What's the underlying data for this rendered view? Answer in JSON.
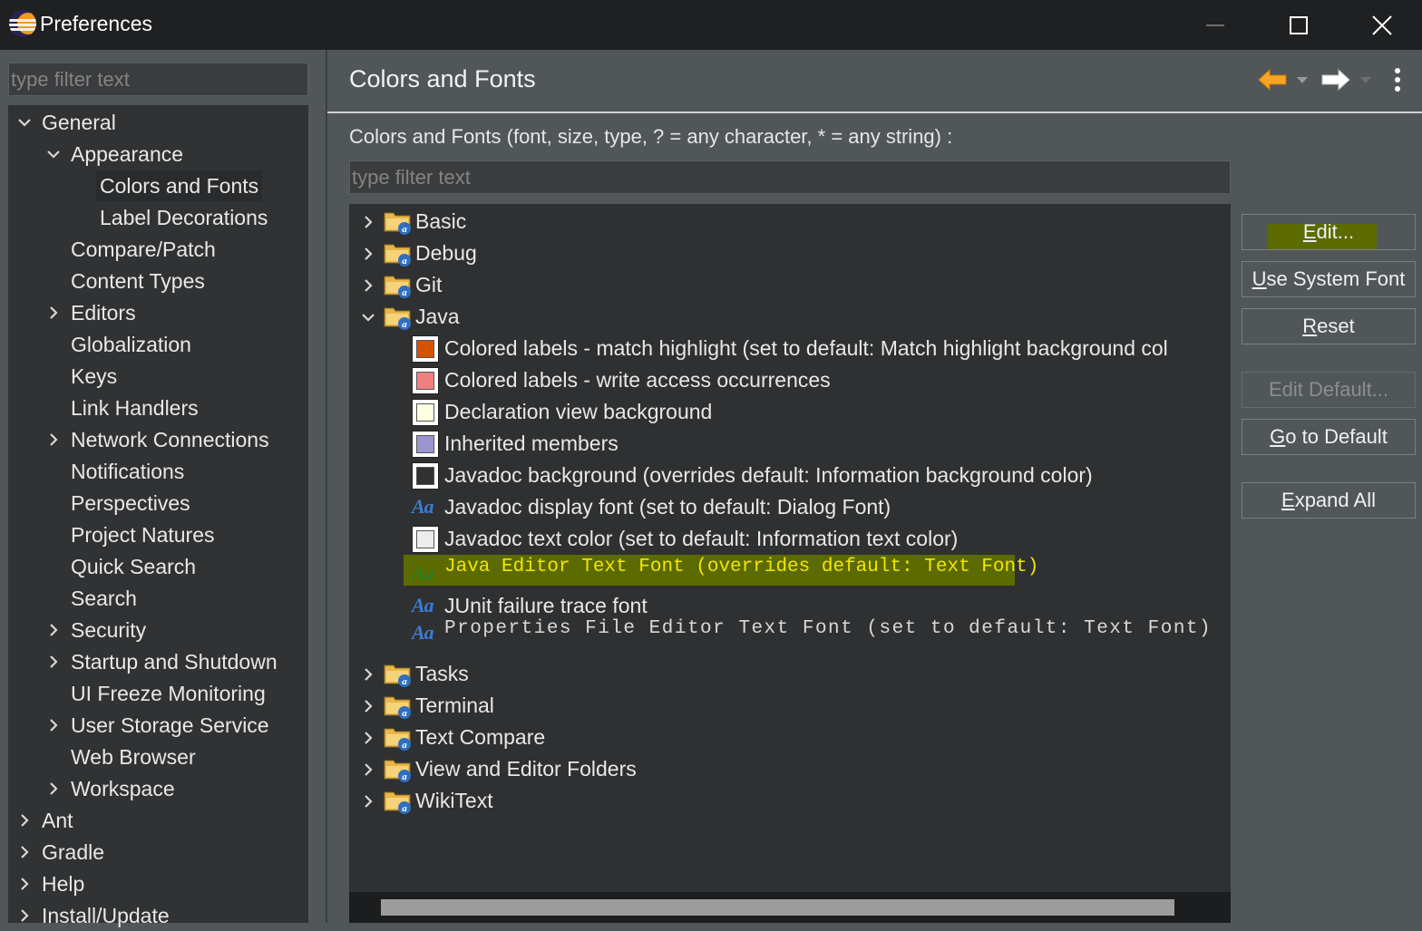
{
  "window": {
    "title": "Preferences",
    "controls": {
      "minimize": "minimize-icon",
      "maximize": "maximize-icon",
      "close": "close-icon"
    }
  },
  "sidebar": {
    "filter_placeholder": "type filter text",
    "items": [
      {
        "label": "General",
        "expanded": true
      },
      {
        "label": "Appearance",
        "expanded": true
      },
      {
        "label": "Colors and Fonts",
        "selected": true
      },
      {
        "label": "Label Decorations"
      },
      {
        "label": "Compare/Patch"
      },
      {
        "label": "Content Types"
      },
      {
        "label": "Editors",
        "expandable": true
      },
      {
        "label": "Globalization"
      },
      {
        "label": "Keys"
      },
      {
        "label": "Link Handlers"
      },
      {
        "label": "Network Connections",
        "expandable": true
      },
      {
        "label": "Notifications"
      },
      {
        "label": "Perspectives"
      },
      {
        "label": "Project Natures"
      },
      {
        "label": "Quick Search"
      },
      {
        "label": "Search"
      },
      {
        "label": "Security",
        "expandable": true
      },
      {
        "label": "Startup and Shutdown",
        "expandable": true
      },
      {
        "label": "UI Freeze Monitoring"
      },
      {
        "label": "User Storage Service",
        "expandable": true
      },
      {
        "label": "Web Browser"
      },
      {
        "label": "Workspace",
        "expandable": true
      },
      {
        "label": "Ant",
        "expandable": true
      },
      {
        "label": "Gradle",
        "expandable": true
      },
      {
        "label": "Help",
        "expandable": true
      },
      {
        "label": "Install/Update",
        "expandable": true
      }
    ]
  },
  "main": {
    "title": "Colors and Fonts",
    "filter_description": "Colors and Fonts (font, size, type, ? = any character, * = any string) :",
    "filter_placeholder": "type filter text",
    "tree": {
      "categories_before": [
        "Basic",
        "Debug",
        "Git"
      ],
      "java": {
        "label": "Java",
        "children": [
          {
            "label": "Colored labels - match highlight (set to default: Match highlight background col",
            "kind": "color",
            "color": "#d35400"
          },
          {
            "label": "Colored labels - write access occurrences",
            "kind": "color",
            "color": "#f08080"
          },
          {
            "label": "Declaration view background",
            "kind": "color",
            "color": "#fefee2"
          },
          {
            "label": "Inherited members",
            "kind": "color",
            "color": "#9b95cf"
          },
          {
            "label": "Javadoc background (overrides default: Information background color)",
            "kind": "color",
            "color": "#2f3133"
          },
          {
            "label": "Javadoc display font (set to default: Dialog Font)",
            "kind": "font"
          },
          {
            "label": "Javadoc text color (set to default: Information text color)",
            "kind": "color",
            "color": "#ececec"
          },
          {
            "label": "Java Editor Text Font (overrides default: Text Font)",
            "kind": "font",
            "selected": true
          },
          {
            "label": "JUnit failure trace font",
            "kind": "font"
          },
          {
            "label": "Properties File Editor Text Font (set to default: Text Font)",
            "kind": "font"
          }
        ]
      },
      "categories_after": [
        "Tasks",
        "Terminal",
        "Text Compare",
        "View and Editor Folders",
        "WikiText"
      ]
    },
    "font_icon_glyph": "Aa"
  },
  "buttons": {
    "edit": {
      "mnemonic": "E",
      "rest": "dit..."
    },
    "use_system_font": {
      "mnemonic": "U",
      "rest": "se System Font"
    },
    "reset": {
      "mnemonic": "R",
      "rest": "eset"
    },
    "edit_default": {
      "label": "Edit Default..."
    },
    "go_to_default": {
      "mnemonic": "G",
      "rest": "o to Default"
    },
    "expand_all": {
      "mnemonic": "E",
      "rest": "xpand All"
    }
  },
  "colors": {
    "highlight": "#5c6b00",
    "highlight_text": "#f2e600",
    "font_icon": "#3a7bd5"
  }
}
